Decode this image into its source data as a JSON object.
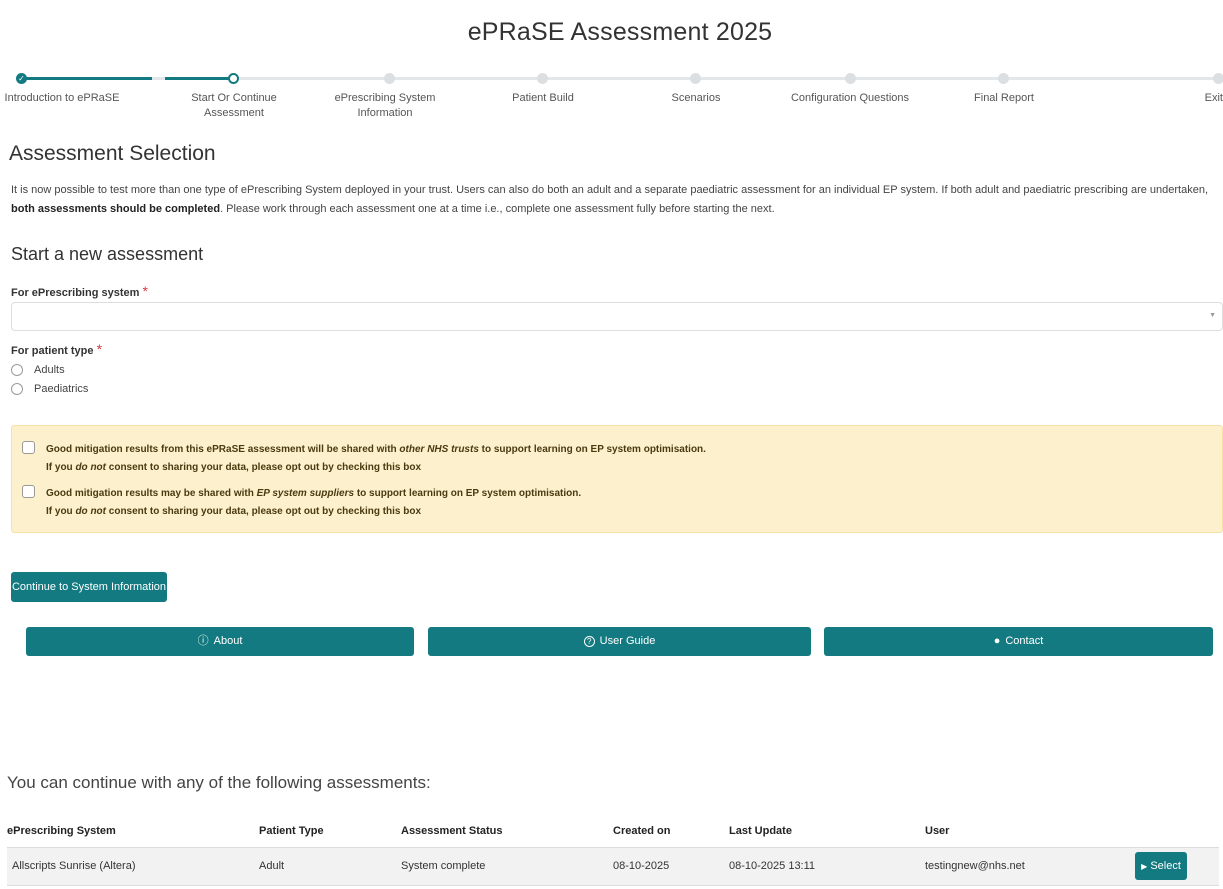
{
  "title": "ePRaSE Assessment 2025",
  "stepper": {
    "steps": [
      {
        "label": "Introduction to ePRaSE",
        "state": "done"
      },
      {
        "label": "Start Or Continue Assessment",
        "state": "current"
      },
      {
        "label": "ePrescribing System Information",
        "state": "todo"
      },
      {
        "label": "Patient Build",
        "state": "todo"
      },
      {
        "label": "Scenarios",
        "state": "todo"
      },
      {
        "label": "Configuration Questions",
        "state": "todo"
      },
      {
        "label": "Final Report",
        "state": "todo"
      },
      {
        "label": "Exit",
        "state": "todo"
      }
    ],
    "done_icon": "check-icon"
  },
  "assessment_selection": {
    "heading": "Assessment Selection",
    "intro_part1": "It is now possible to test more than one type of ePrescribing System deployed in your trust. Users can also do both an adult and a separate paediatric assessment for an individual EP system. If both adult and paediatric prescribing are undertaken, ",
    "intro_bold": "both assessments should be completed",
    "intro_part2": ". Please work through each assessment one at a time i.e., complete one assessment fully before starting the next."
  },
  "new_assessment": {
    "heading": "Start a new assessment",
    "system_label": "For ePrescribing system",
    "system_value": "",
    "required_mark": "*",
    "patient_type_label": "For patient type",
    "patient_types": [
      "Adults",
      "Paediatrics"
    ]
  },
  "consent": {
    "item1_line1_a": "Good mitigation results from this ePRaSE assessment will be shared with ",
    "item1_line1_em": "other NHS trusts",
    "item1_line1_b": " to support learning on EP system optimisation.",
    "item1_line2_a": "If you ",
    "item1_line2_em": "do not",
    "item1_line2_b": " consent to sharing your data, please opt out by checking this box",
    "item2_line1_a": "Good mitigation results may be shared with ",
    "item2_line1_em": "EP system suppliers",
    "item2_line1_b": " to support learning on EP system optimisation.",
    "item2_line2_a": "If you ",
    "item2_line2_em": "do not",
    "item2_line2_b": " consent to sharing your data, please opt out by checking this box"
  },
  "continue_button": "Continue to System Information",
  "footer_buttons": [
    {
      "label": "About",
      "icon": "info-icon",
      "glyph": "ⓘ"
    },
    {
      "label": "User Guide",
      "icon": "help-icon",
      "glyph": "?"
    },
    {
      "label": "Contact",
      "icon": "user-circle-icon",
      "glyph": "●"
    }
  ],
  "existing": {
    "heading": "You can continue with any of the following assessments:",
    "columns": [
      "ePrescribing System",
      "Patient Type",
      "Assessment Status",
      "Created on",
      "Last Update",
      "User"
    ],
    "rows": [
      {
        "system": "Allscripts Sunrise (Altera)",
        "patient_type": "Adult",
        "status": "System complete",
        "created": "08-10-2025",
        "updated": "08-10-2025 13:11",
        "user": "testingnew@nhs.net",
        "action": "Select"
      }
    ]
  },
  "colors": {
    "accent": "#127a80",
    "warning_bg": "#fdf1cd",
    "required": "#d9383a"
  }
}
